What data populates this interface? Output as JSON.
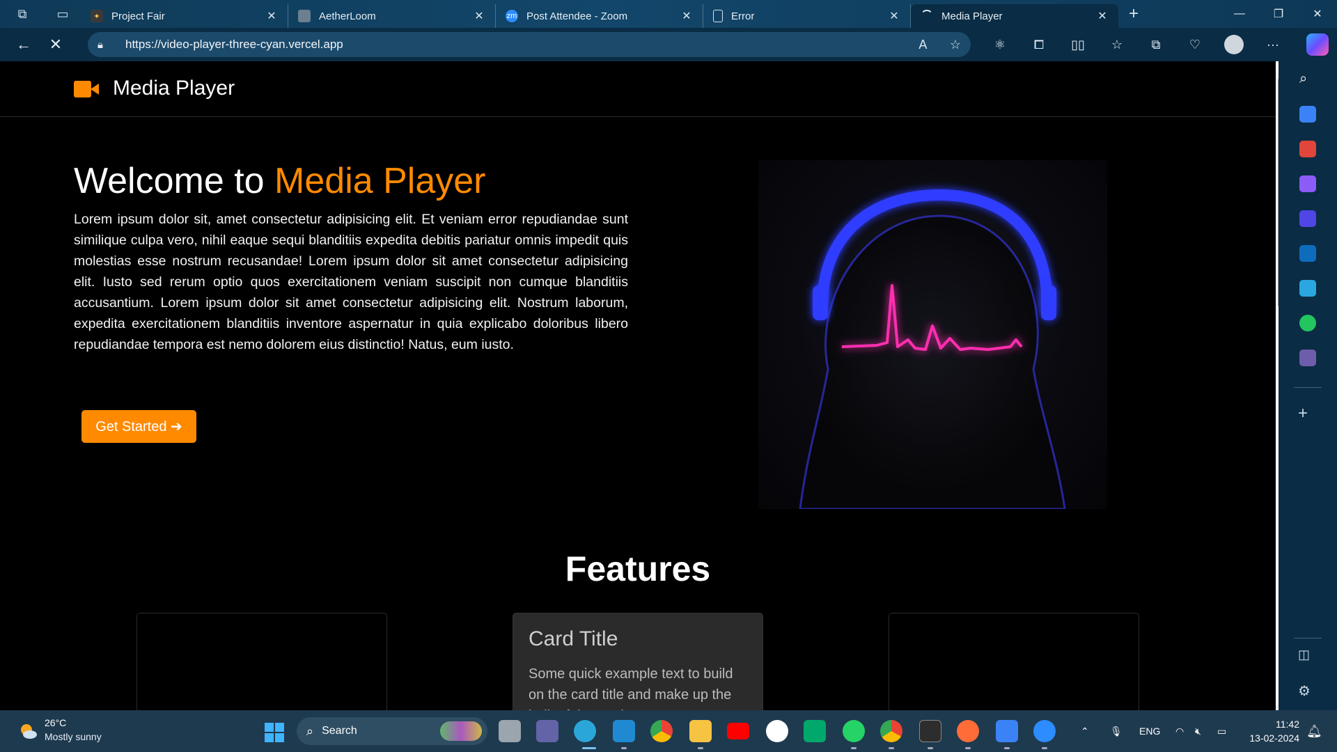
{
  "browser": {
    "tabs": [
      {
        "title": "Project Fair",
        "active": false
      },
      {
        "title": "AetherLoom",
        "active": false
      },
      {
        "title": "Post Attendee - Zoom",
        "active": false
      },
      {
        "title": "Error",
        "active": false
      },
      {
        "title": "Media Player",
        "active": true
      }
    ],
    "url": "https://video-player-three-cyan.vercel.app",
    "tab_close_glyph": "✕",
    "new_tab_glyph": "+"
  },
  "page": {
    "brand": "Media Player",
    "hero": {
      "title_prefix": "Welcome to ",
      "title_accent": "Media Player",
      "body": "Lorem ipsum dolor sit, amet consectetur adipisicing elit. Et veniam error repudiandae sunt similique culpa vero, nihil eaque sequi blanditiis expedita debitis pariatur omnis impedit quis molestias esse nostrum recusandae! Lorem ipsum dolor sit amet consectetur adipisicing elit. Iusto sed rerum optio quos exercitationem veniam suscipit non cumque blanditiis accusantium. Lorem ipsum dolor sit amet consectetur adipisicing elit. Nostrum laborum, expedita exercitationem blanditiis inventore aspernatur in quia explicabo doloribus libero repudiandae tempora est nemo dolorem eius distinctio! Natus, eum iusto.",
      "cta_label": "Get Started ➔"
    },
    "features": {
      "title": "Features",
      "cards": [
        {
          "title": "",
          "text": ""
        },
        {
          "title": "Card Title",
          "text": "Some quick example text to build on the card title and make up the bulk of the card's content."
        },
        {
          "title": "",
          "text": ""
        }
      ]
    },
    "colors": {
      "accent": "#ff8a00",
      "background": "#000000",
      "card_mid": "#2b2b2b"
    }
  },
  "taskbar": {
    "weather": {
      "temp": "26°C",
      "desc": "Mostly sunny"
    },
    "search_label": "Search",
    "tray": {
      "language": "ENG"
    },
    "clock": {
      "time": "11:42",
      "date": "13-02-2024"
    }
  }
}
